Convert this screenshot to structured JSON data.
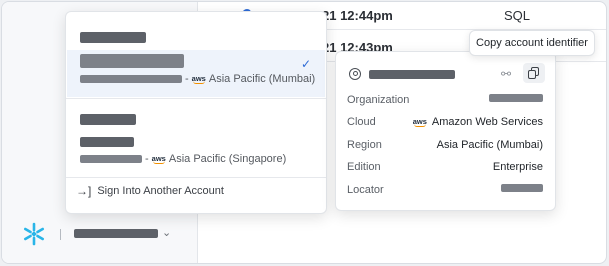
{
  "background": {
    "rows": [
      {
        "time": "21 12:44pm",
        "type": "SQL"
      },
      {
        "time": "21 12:43pm",
        "type": ""
      }
    ]
  },
  "dropdown": {
    "groups": [
      {
        "accounts": [
          {
            "region": "Asia Pacific (Mumbai)",
            "provider_separator": "-",
            "provider_icon": "aws-logo-icon",
            "selected": true
          }
        ]
      },
      {
        "accounts": [
          {
            "region": "Asia Pacific (Singapore)",
            "provider_separator": "-",
            "provider_icon": "aws-logo-icon",
            "selected": false
          }
        ]
      }
    ],
    "sign_in_label": "Sign Into Another Account",
    "sign_in_icon": "sign-in-icon"
  },
  "account_card": {
    "rows": [
      {
        "label": "Organization",
        "value": ""
      },
      {
        "label": "Cloud",
        "value": "Amazon Web Services",
        "icon": "aws-logo-icon"
      },
      {
        "label": "Region",
        "value": "Asia Pacific (Mumbai)"
      },
      {
        "label": "Edition",
        "value": "Enterprise"
      },
      {
        "label": "Locator",
        "value": ""
      }
    ]
  },
  "tooltip": {
    "text": "Copy account identifier"
  },
  "aws_wordmark": "aws",
  "colors": {
    "accent": "#2e6bd6",
    "snowflake": "#29b5e8",
    "selected_bg": "#eef3fb"
  }
}
